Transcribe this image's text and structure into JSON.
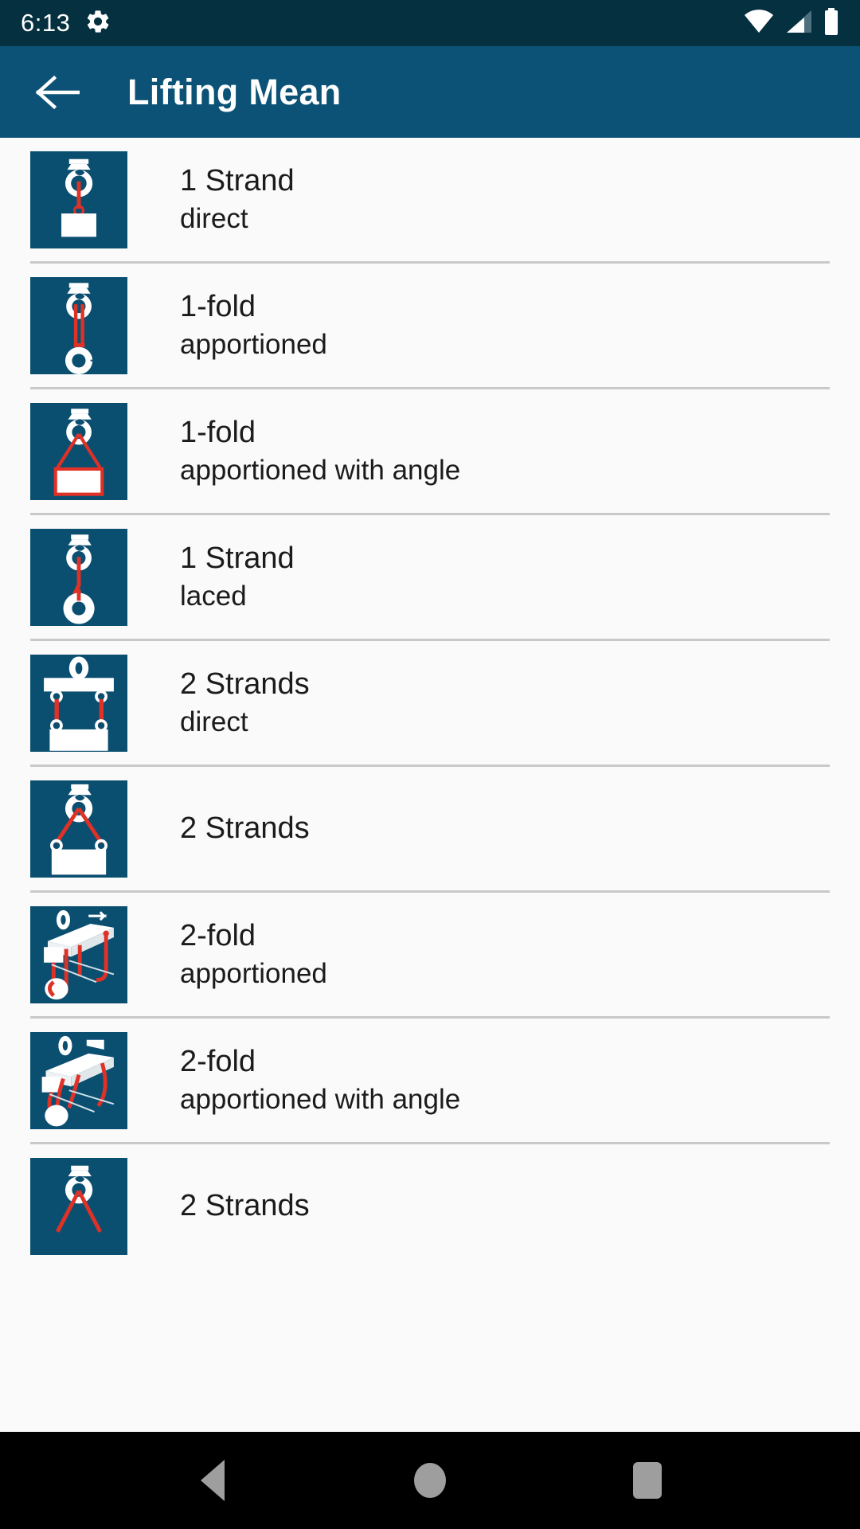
{
  "status_bar": {
    "time": "6:13",
    "icons": [
      "gear-icon",
      "wifi-icon",
      "cellular-signal-icon",
      "battery-icon"
    ],
    "background": "#05303f"
  },
  "app_bar": {
    "title": "Lifting Mean",
    "back_label": "Back",
    "background": "#0b5276"
  },
  "theme": {
    "thumb_blue": "#0b4f70",
    "rope_red": "#e03127",
    "page_bg": "#fafafa",
    "divider": "#c9c9c9"
  },
  "list": {
    "items": [
      {
        "title": "1 Strand",
        "subtitle": "direct",
        "icon": "hook-single-strand-load-icon"
      },
      {
        "title": "1-fold",
        "subtitle": "apportioned",
        "icon": "hook-single-fold-pulley-icon"
      },
      {
        "title": "1-fold",
        "subtitle": "apportioned with angle",
        "icon": "hook-single-fold-angle-load-icon"
      },
      {
        "title": "1 Strand",
        "subtitle": "laced",
        "icon": "hook-single-strand-laced-ring-icon"
      },
      {
        "title": "2 Strands",
        "subtitle": "direct",
        "icon": "beam-two-strands-direct-icon"
      },
      {
        "title": "2 Strands",
        "subtitle": "",
        "icon": "hook-two-strands-angle-load-icon"
      },
      {
        "title": "2-fold",
        "subtitle": "apportioned",
        "icon": "trolley-two-fold-apportioned-icon"
      },
      {
        "title": "2-fold",
        "subtitle": "apportioned with angle",
        "icon": "trolley-two-fold-angle-icon"
      },
      {
        "title": "2 Strands",
        "subtitle": "",
        "icon": "hook-two-strands-partial-icon"
      }
    ]
  },
  "nav_bar": {
    "back_label": "Back",
    "home_label": "Home",
    "recents_label": "Recents",
    "background": "#000000"
  }
}
